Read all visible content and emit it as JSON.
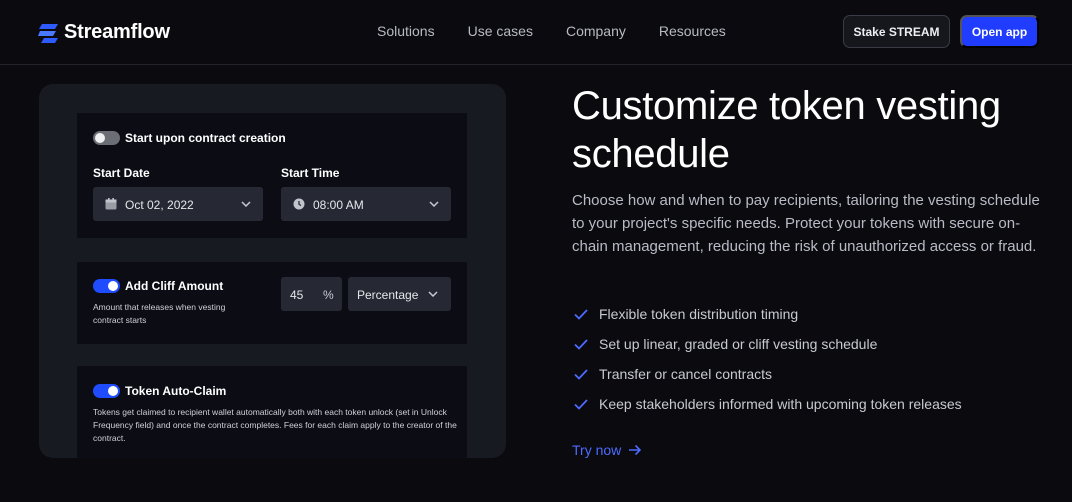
{
  "nav": {
    "brand": "Streamflow",
    "menu": [
      "Solutions",
      "Use cases",
      "Company",
      "Resources"
    ],
    "stake_label": "Stake STREAM",
    "open_label": "Open app"
  },
  "panel": {
    "card1": {
      "toggle_label": "Start upon contract creation",
      "toggle_on": false,
      "start_date_label": "Start Date",
      "start_date_value": "Oct 02, 2022",
      "start_time_label": "Start Time",
      "start_time_value": "08:00 AM"
    },
    "card2": {
      "toggle_label": "Add Cliff Amount",
      "toggle_on": true,
      "description": "Amount that releases when vesting contract starts",
      "amount_value": "45",
      "amount_unit": "%",
      "type_value": "Percentage"
    },
    "card3": {
      "toggle_label": "Token Auto-Claim",
      "toggle_on": true,
      "description": "Tokens get claimed to recipient wallet automatically both with each token unlock (set in Unlock Frequency field) and once the contract completes. Fees for each claim apply to the creator of the contract."
    }
  },
  "hero": {
    "title": "Customize token vesting schedule",
    "description": "Choose how and when to pay recipients, tailoring the vesting schedule to your project's specific needs. Protect your tokens with secure on-chain management, reducing the risk of unauthorized access or fraud.",
    "features": [
      "Flexible token distribution timing",
      "Set up linear, graded or cliff vesting schedule",
      "Transfer or cancel contracts",
      "Keep stakeholders informed with upcoming token releases"
    ],
    "cta": "Try now"
  },
  "colors": {
    "accent": "#1f3cff",
    "link": "#4d6bff",
    "check": "#4d6bff"
  }
}
